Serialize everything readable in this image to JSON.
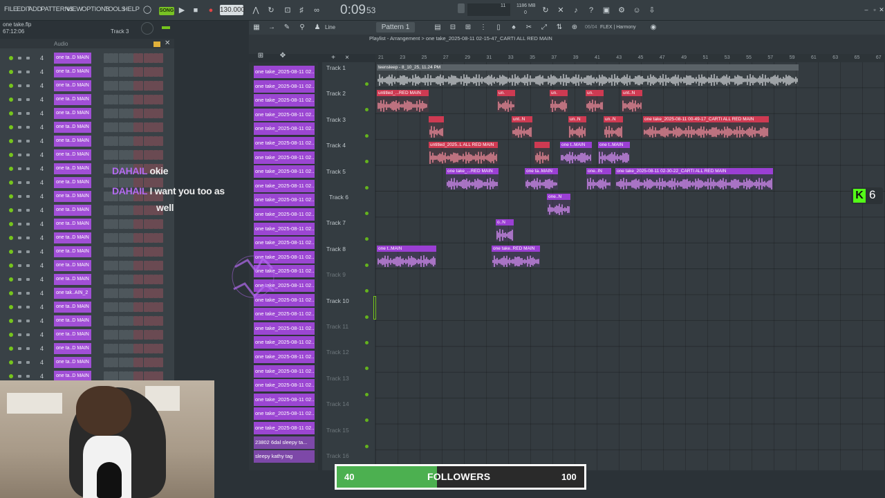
{
  "menu": [
    "FILE",
    "EDIT",
    "ADD",
    "PATTERNS",
    "VIEW",
    "OPTIONS",
    "TOOLS",
    "HELP"
  ],
  "transport": {
    "mode": "SONG",
    "bpm": "130.000",
    "time": "0:09",
    "time_ms": "53",
    "cpu": "11",
    "mem": "1186 MB",
    "poly": "0"
  },
  "toolbar": {
    "snap": "Line",
    "pattern": "Pattern 1",
    "preset_index": "06/04",
    "preset_name": "FLEX | Harmony"
  },
  "hint": {
    "file": "one take.flp",
    "time": "67:12:06",
    "channel": "Track 3"
  },
  "rack": {
    "header": "Audio",
    "rows": [
      {
        "num": "4",
        "name": "one ta..D MAIN"
      },
      {
        "num": "4",
        "name": "one ta..D MAIN"
      },
      {
        "num": "4",
        "name": "one ta..D MAIN"
      },
      {
        "num": "4",
        "name": "one ta..D MAIN"
      },
      {
        "num": "4",
        "name": "one ta..D MAIN"
      },
      {
        "num": "4",
        "name": "one ta..D MAIN"
      },
      {
        "num": "4",
        "name": "one ta..D MAIN"
      },
      {
        "num": "4",
        "name": "one ta..D MAIN"
      },
      {
        "num": "4",
        "name": "one ta..D MAIN"
      },
      {
        "num": "4",
        "name": "one ta..D MAIN"
      },
      {
        "num": "4",
        "name": "one ta..D MAIN"
      },
      {
        "num": "4",
        "name": "one ta..D MAIN"
      },
      {
        "num": "4",
        "name": "one ta..D MAIN"
      },
      {
        "num": "4",
        "name": "one ta..D MAIN"
      },
      {
        "num": "4",
        "name": "one ta..D MAIN"
      },
      {
        "num": "4",
        "name": "one ta..D MAIN"
      },
      {
        "num": "4",
        "name": "one ta..D MAIN"
      },
      {
        "num": "4",
        "name": "one tak..AIN_2"
      },
      {
        "num": "4",
        "name": "one ta..D MAIN"
      },
      {
        "num": "4",
        "name": "one ta..D MAIN"
      },
      {
        "num": "4",
        "name": "one ta..D MAIN"
      },
      {
        "num": "4",
        "name": "one ta..D MAIN"
      },
      {
        "num": "4",
        "name": "one ta..D MAIN"
      },
      {
        "num": "4",
        "name": "one ta..D MAIN"
      },
      {
        "num": "4",
        "name": "one ta..D MAIN"
      }
    ]
  },
  "chat": [
    {
      "user": "DAHAIL",
      "msg": "okie"
    },
    {
      "user": "DAHAIL",
      "msg": "I want you too as",
      "msg2": "well"
    }
  ],
  "playlist_title": "Playlist - Arrangement > one take_2025-08-11 02-15-47_CARTI ALL RED MAIN",
  "patterns": [
    "one take_2025-08-11 02...",
    "one take_2025-08-11 02...",
    "one take_2025-08-11 02...",
    "one take_2025-08-11 02...",
    "one take_2025-08-11 02...",
    "one take_2025-08-11 02...",
    "one take_2025-08-11 02...",
    "one take_2025-08-11 02...",
    "one take_2025-08-11 02...",
    "one take_2025-08-11 02...",
    "one take_2025-08-11 02...",
    "one take_2025-08-11 02...",
    "one take_2025-08-11 02...",
    "one take_2025-08-11 02...",
    "one take_2025-08-11 02...",
    "one take_2025-08-11 02...",
    "one take_2025-08-11 02...",
    "one take_2025-08-11 02...",
    "one take_2025-08-11 02...",
    "one take_2025-08-11 02...",
    "one take_2025-08-11 02...",
    "one take_2025-08-11 02...",
    "one take_2025-08-11 02...",
    "one take_2025-08-11 02...",
    "one take_2025-08-11 02...",
    "one take_2025-08-11 02...",
    "23802 6dal sleepy ta...",
    "sleepy kathy tag"
  ],
  "tracks": [
    "Track 1",
    "Track 2",
    "Track 3",
    "Track 4",
    "Track 5",
    "Track 6",
    "Track 7",
    "Track 8",
    "Track 9",
    "Track 10",
    "Track 11",
    "Track 12",
    "Track 13",
    "Track 14",
    "Track 15",
    "Track 16"
  ],
  "ruler": [
    "21",
    "23",
    "25",
    "27",
    "29",
    "31",
    "33",
    "35",
    "37",
    "39",
    "41",
    "43",
    "45",
    "47",
    "49",
    "51",
    "53",
    "55",
    "57",
    "59",
    "61",
    "63",
    "65",
    "67"
  ],
  "clips": [
    {
      "track": 0,
      "start": 0,
      "len": 610,
      "label": "teensleep - 8_10_25, 11.24 PM",
      "color": "gry"
    },
    {
      "track": 1,
      "start": 0,
      "len": 75,
      "label": "untitled_...RED MAIN",
      "color": "red"
    },
    {
      "track": 1,
      "start": 174,
      "len": 26,
      "label": "un.",
      "color": "red"
    },
    {
      "track": 1,
      "start": 250,
      "len": 26,
      "label": "un.",
      "color": "red"
    },
    {
      "track": 1,
      "start": 302,
      "len": 26,
      "label": "un.",
      "color": "red"
    },
    {
      "track": 1,
      "start": 354,
      "len": 30,
      "label": "unt..N",
      "color": "red"
    },
    {
      "track": 2,
      "start": 75,
      "len": 22,
      "label": "",
      "color": "red"
    },
    {
      "track": 2,
      "start": 195,
      "len": 30,
      "label": "unt..N",
      "color": "red"
    },
    {
      "track": 2,
      "start": 277,
      "len": 26,
      "label": "un..N",
      "color": "red"
    },
    {
      "track": 2,
      "start": 328,
      "len": 28,
      "label": "un..N",
      "color": "red"
    },
    {
      "track": 2,
      "start": 385,
      "len": 182,
      "label": "one take_2025-08-11 00-49-17_CARTI ALL RED MAIN",
      "color": "red"
    },
    {
      "track": 3,
      "start": 75,
      "len": 100,
      "label": "untitled_2025..L ALL RED MAIN",
      "color": "red"
    },
    {
      "track": 3,
      "start": 228,
      "len": 22,
      "label": "",
      "color": "red"
    },
    {
      "track": 3,
      "start": 265,
      "len": 46,
      "label": "one t..MAIN",
      "color": "pur"
    },
    {
      "track": 3,
      "start": 320,
      "len": 46,
      "label": "one t..MAIN",
      "color": "pur"
    },
    {
      "track": 4,
      "start": 100,
      "len": 76,
      "label": "one take_...RED MAIN",
      "color": "pur"
    },
    {
      "track": 4,
      "start": 214,
      "len": 48,
      "label": "one ta..MAIN",
      "color": "pur"
    },
    {
      "track": 4,
      "start": 303,
      "len": 36,
      "label": "one..IN",
      "color": "pur"
    },
    {
      "track": 4,
      "start": 345,
      "len": 228,
      "label": "one take_2025-08-11 02-30-22_CARTI ALL RED MAIN",
      "color": "pur"
    },
    {
      "track": 5,
      "start": 246,
      "len": 34,
      "label": "one..N",
      "color": "pur"
    },
    {
      "track": 6,
      "start": 172,
      "len": 26,
      "label": "o..N",
      "color": "pur"
    },
    {
      "track": 7,
      "start": 0,
      "len": 86,
      "label": "one t..MAIN",
      "color": "pur"
    },
    {
      "track": 7,
      "start": 166,
      "len": 70,
      "label": "one take..RED MAIN",
      "color": "pur"
    }
  ],
  "kick": {
    "count": "6"
  },
  "followers": {
    "current": 40,
    "goal": 100,
    "label": "FOLLOWERS"
  },
  "colors": {
    "accent": "#9b46d2",
    "clip_red": "#cf3a52",
    "led": "#76c51d",
    "progress": "#4cb050"
  }
}
